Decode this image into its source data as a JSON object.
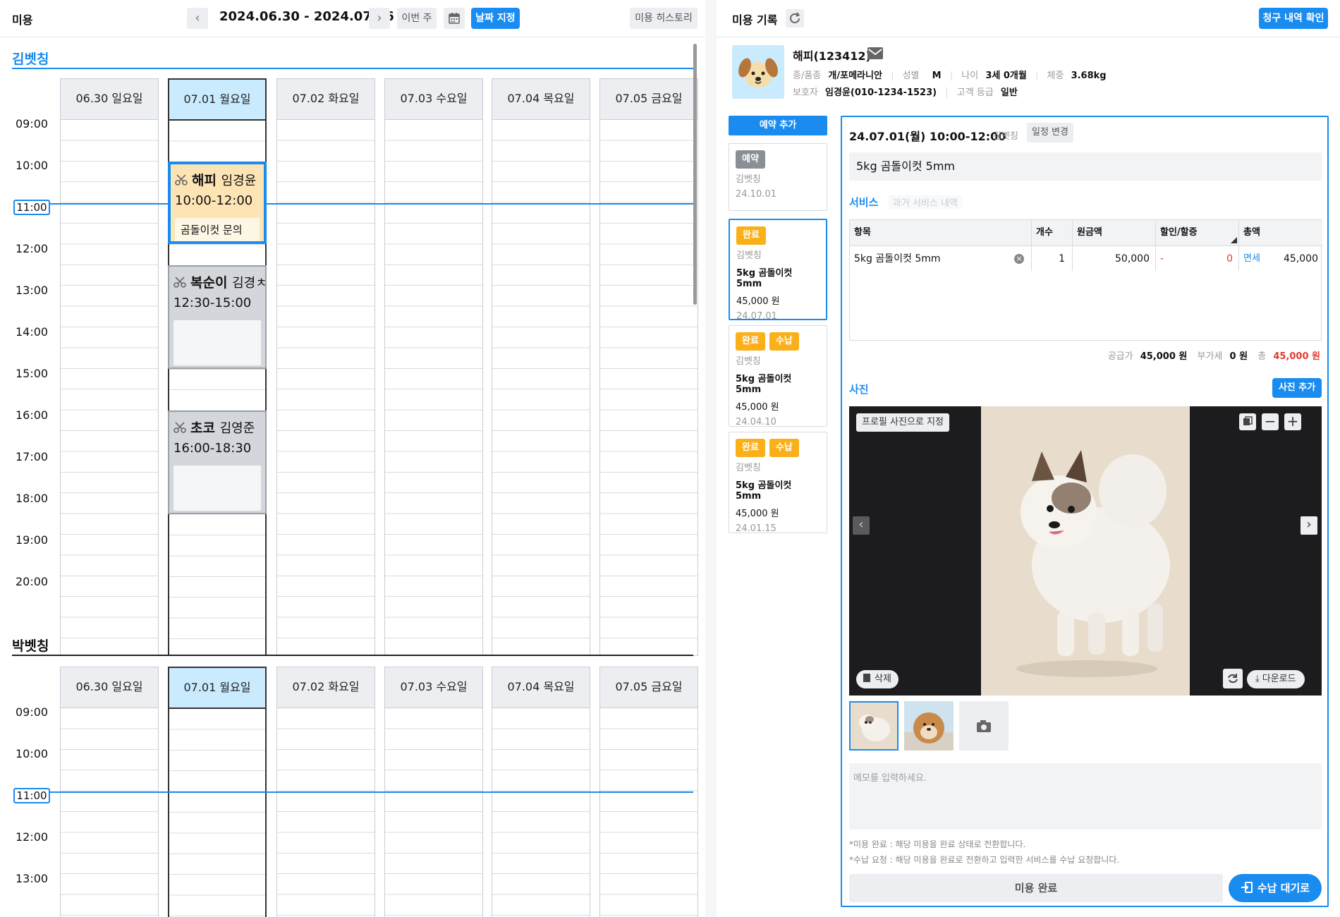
{
  "left_header": {
    "title": "미용",
    "date_range": "2024.06.30 - 2024.07.06",
    "prev": "‹",
    "next": "›",
    "this_week": "이번 주",
    "set_date": "날짜 지정",
    "history": "미용 히스토리"
  },
  "days": [
    "06.30 일요일",
    "07.01 월요일",
    "07.02 화요일",
    "07.03 수요일",
    "07.04 목요일",
    "07.05 금요일"
  ],
  "times": [
    "09:00",
    "10:00",
    "11:00",
    "12:00",
    "13:00",
    "14:00",
    "15:00",
    "16:00",
    "17:00",
    "18:00",
    "19:00",
    "20:00"
  ],
  "times2": [
    "09:00",
    "10:00",
    "11:00",
    "12:00",
    "13:00"
  ],
  "groomers": [
    {
      "name": "김벳칭"
    },
    {
      "name": "박벳칭"
    }
  ],
  "appointments": [
    {
      "pet": "해피",
      "owner": "임경윤",
      "time": "10:00-12:00",
      "memo": "곰돌이컷 문의"
    },
    {
      "pet": "복순이",
      "owner": "김경ㅊ",
      "time": "12:30-15:00",
      "memo": ""
    },
    {
      "pet": "초코",
      "owner": "김영준",
      "time": "16:00-18:30",
      "memo": ""
    }
  ],
  "right_header": {
    "title": "미용 기록",
    "billing_btn": "청구 내역 확인"
  },
  "pet": {
    "name": "해피(123412)",
    "breed_label": "종/품종",
    "breed": "개/포메라니안",
    "sex_label": "성별",
    "sex": "M",
    "age_label": "나이",
    "age": "3세 0개월",
    "weight_label": "체중",
    "weight": "3.68kg",
    "guardian_label": "보호자",
    "guardian": "임경윤(010-1234-1523)",
    "grade_label": "고객 등급",
    "grade": "일반"
  },
  "add_reservation": "예약 추가",
  "history_cards": [
    {
      "tags": [
        "예약"
      ],
      "groomer": "김벳칭",
      "service": "",
      "price": "",
      "date": "24.10.01"
    },
    {
      "tags": [
        "완료"
      ],
      "groomer": "김벳칭",
      "service": "5kg 곰돌이컷 5mm",
      "price": "45,000 원",
      "date": "24.07.01"
    },
    {
      "tags": [
        "완료",
        "수납"
      ],
      "groomer": "김벳칭",
      "service": "5kg 곰돌이컷 5mm",
      "price": "45,000 원",
      "date": "24.04.10"
    },
    {
      "tags": [
        "완료",
        "수납"
      ],
      "groomer": "김벳칭",
      "service": "5kg 곰돌이컷 5mm",
      "price": "45,000 원",
      "date": "24.01.15"
    }
  ],
  "detail": {
    "datetime": "24.07.01(월) 10:00-12:00",
    "groomer": "김벳칭",
    "change_btn": "일정 변경",
    "memo_title": "5kg 곰돌이컷 5mm"
  },
  "services": {
    "tab": "서비스",
    "tab2": "과거 서비스 내역",
    "headers": [
      "항목",
      "개수",
      "원금액",
      "할인/할증",
      "총액"
    ],
    "row": {
      "item": "5kg 곰돌이컷 5mm",
      "count": "1",
      "amount": "50,000",
      "disc_sign": "-",
      "disc": "0",
      "tax": "면세",
      "total": "45,000"
    },
    "supply_label": "공급가",
    "supply": "45,000 원",
    "vat_label": "부가세",
    "vat": "0 원",
    "total_label": "총",
    "total": "45,000 원"
  },
  "photos": {
    "title": "사진",
    "add_btn": "사진 추가",
    "profile_btn": "프로필 사진으로 지정",
    "delete_btn": "삭제",
    "download_btn": "다운로드"
  },
  "memo_placeholder": "메모를 입력하세요.",
  "notes": [
    "*미용 완료 : 해당 미용을 완료 상태로 전환합니다.",
    "*수납 요청 : 해당 미용을 완료로 전환하고 입력한 서비스를 수납 요청합니다."
  ],
  "complete_btn": "미용 완료",
  "payment_btn": "수납 대기로",
  "colors": {
    "accent": "#1a8cf0",
    "orange": "#fbb01a",
    "selected_day": "#c9ebfd",
    "highlight": "#fde4b5"
  }
}
